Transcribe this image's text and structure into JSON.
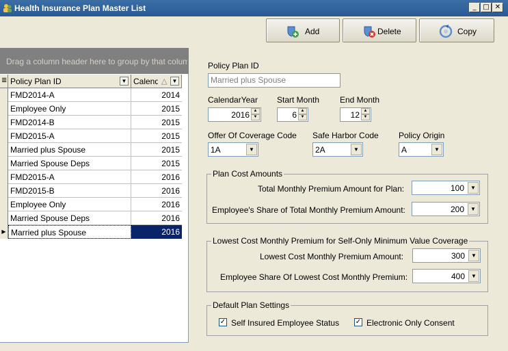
{
  "window": {
    "title": "Health Insurance Plan Master List",
    "minimize_glyph": "_",
    "restore_glyph": "□",
    "close_glyph": "✕"
  },
  "toolbar": {
    "add_label": "Add",
    "delete_label": "Delete",
    "copy_label": "Copy"
  },
  "grid": {
    "group_hint": "Drag a column header here to group by that column",
    "headers": [
      "Policy Plan ID",
      "Calendar"
    ],
    "sort_glyph": "△",
    "rows": [
      {
        "id": "FMD2014-A",
        "year": "2014"
      },
      {
        "id": "Employee Only",
        "year": "2015"
      },
      {
        "id": "FMD2014-B",
        "year": "2015"
      },
      {
        "id": "FMD2015-A",
        "year": "2015"
      },
      {
        "id": "Married plus Spouse",
        "year": "2015"
      },
      {
        "id": "Married Spouse Deps",
        "year": "2015"
      },
      {
        "id": "FMD2015-A",
        "year": "2016"
      },
      {
        "id": "FMD2015-B",
        "year": "2016"
      },
      {
        "id": "Employee Only",
        "year": "2016"
      },
      {
        "id": "Married Spouse Deps",
        "year": "2016"
      },
      {
        "id": "Married plus Spouse",
        "year": "2016"
      }
    ],
    "selected_index": 10
  },
  "form": {
    "policy_plan_id_label": "Policy Plan ID",
    "policy_plan_id_value": "Married plus Spouse",
    "calendar_year_label": "CalendarYear",
    "calendar_year_value": "2016",
    "start_month_label": "Start Month",
    "start_month_value": "6",
    "end_month_label": "End Month",
    "end_month_value": "12",
    "offer_code_label": "Offer Of Coverage Code",
    "offer_code_value": "1A",
    "safe_harbor_label": "Safe Harbor Code",
    "safe_harbor_value": "2A",
    "policy_origin_label": "Policy Origin",
    "policy_origin_value": "A",
    "plan_cost": {
      "legend": "Plan Cost Amounts",
      "total_label": "Total Monthly Premium Amount for Plan:",
      "total_value": "100",
      "employee_share_label": "Employee's Share of Total Monthly Premium Amount:",
      "employee_share_value": "200"
    },
    "lowest_cost": {
      "legend": "Lowest Cost Monthly Premium for Self-Only Minimum Value Coverage",
      "amount_label": "Lowest Cost Monthly Premium Amount:",
      "amount_value": "300",
      "employee_share_label": "Employee Share Of Lowest Cost Monthly Premium:",
      "employee_share_value": "400"
    },
    "default_settings": {
      "legend": "Default Plan Settings",
      "self_insured_label": "Self Insured Employee Status",
      "self_insured_checked": true,
      "electronic_label": "Electronic Only Consent",
      "electronic_checked": true
    }
  },
  "glyphs": {
    "check": "✓",
    "spin_up": "▲",
    "spin_down": "▼",
    "dropdown": "▼",
    "row_pointer": "▶",
    "column_chooser": "≣"
  },
  "colors": {
    "titlebar": "#3a6ea5",
    "selection": "#0a246a",
    "group_area": "#808080",
    "window_bg": "#ece9d8"
  }
}
